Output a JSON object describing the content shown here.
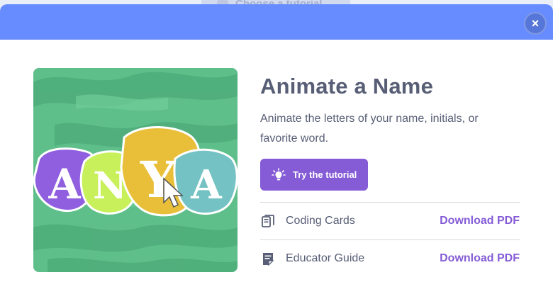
{
  "background": {
    "behind_label": "Choose a tutorial"
  },
  "modal": {
    "close_symbol": "×",
    "title": "Animate a Name",
    "description": "Animate the letters of your name, initials, or favorite word.",
    "try_button_label": "Try the tutorial",
    "thumbnail_letters": [
      "A",
      "N",
      "Y",
      "A"
    ],
    "resources": [
      {
        "icon": "cards-icon",
        "label": "Coding Cards",
        "action_label": "Download PDF"
      },
      {
        "icon": "guide-icon",
        "label": "Educator Guide",
        "action_label": "Download PDF"
      }
    ]
  },
  "colors": {
    "header": "#668cff",
    "accent": "#855cd6",
    "text": "#575e75",
    "thumbnail_green": "#5fbf8a"
  }
}
